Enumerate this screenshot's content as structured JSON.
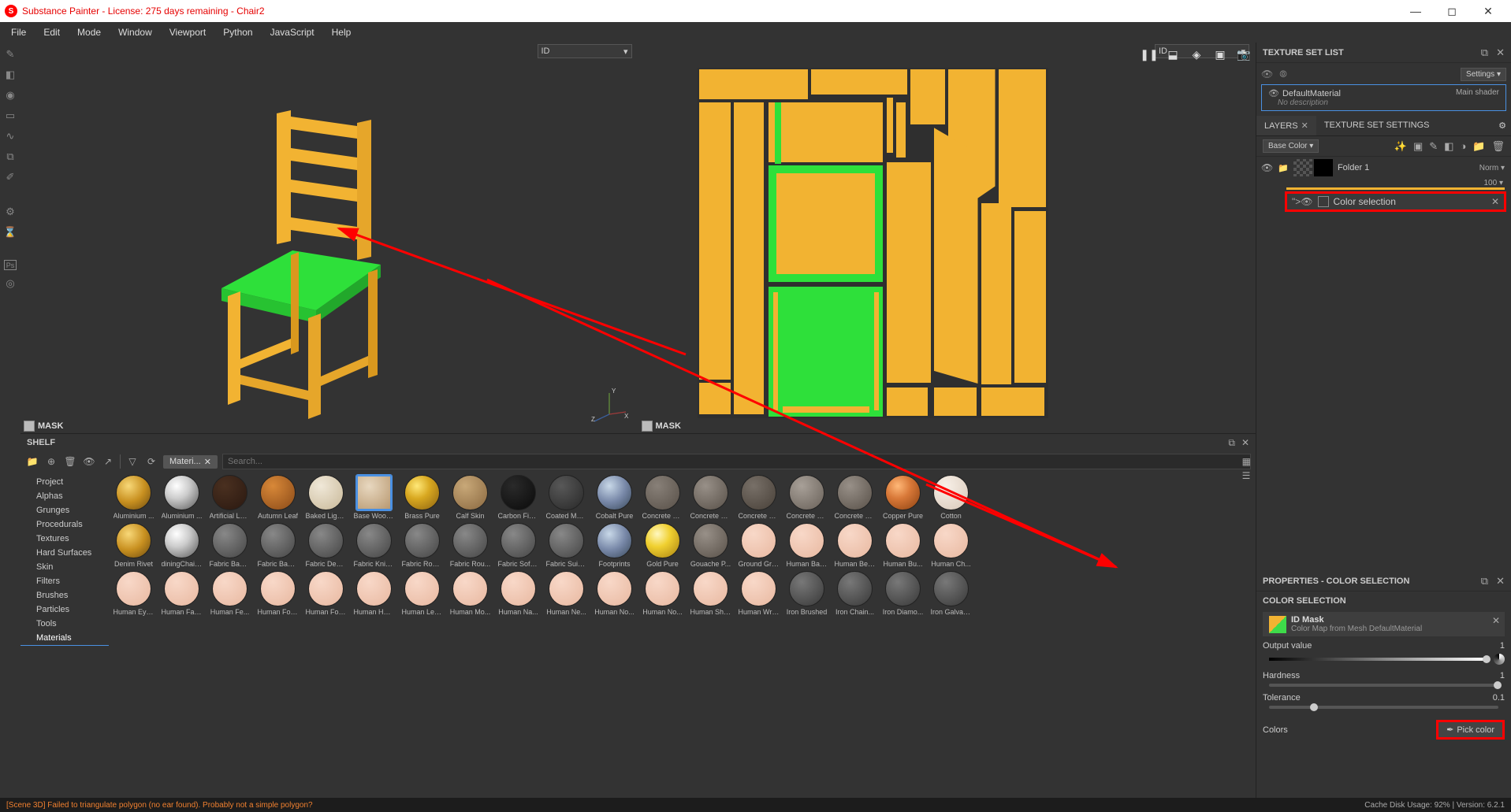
{
  "titlebar": {
    "title": "Substance Painter - License: 275 days remaining - Chair2"
  },
  "menu": [
    "File",
    "Edit",
    "Mode",
    "Window",
    "Viewport",
    "Python",
    "JavaScript",
    "Help"
  ],
  "viewport3d": {
    "dropdown": "ID",
    "footer_label": "MASK"
  },
  "viewport2d": {
    "dropdown": "ID",
    "footer_label": "MASK"
  },
  "shelf": {
    "title": "SHELF",
    "tab_label": "Materi...",
    "search_placeholder": "Search...",
    "categories": [
      "Project",
      "Alphas",
      "Grunges",
      "Procedurals",
      "Textures",
      "Hard Surfaces",
      "Skin",
      "Filters",
      "Brushes",
      "Particles",
      "Tools",
      "Materials"
    ],
    "materials_rows": [
      [
        "Aluminium ...",
        "Aluminium ...",
        "Artificial Lea...",
        "Autumn Leaf",
        "Baked Light...",
        "Base Wood...",
        "Brass Pure",
        "Calf Skin",
        "Carbon Fiber",
        "Coated Metal",
        "Cobalt Pure",
        "Concrete B...",
        "Concrete Cl...",
        "Concrete D...",
        "Concrete Si...",
        "Concrete S...",
        "Copper Pure",
        "Cotton"
      ],
      [
        "Denim Rivet",
        "diningChair...",
        "Fabric Bam...",
        "Fabric Base...",
        "Fabric Deni...",
        "Fabric Knitt...",
        "Fabric Rough",
        "Fabric Rou...",
        "Fabric Soft ...",
        "Fabric Suit ...",
        "Footprints",
        "Gold Pure",
        "Gouache P...",
        "Ground Gra...",
        "Human Bac...",
        "Human Bell...",
        "Human Bu...",
        "Human Ch..."
      ],
      [
        "Human Eye...",
        "Human Fac...",
        "Human Fe...",
        "Human For...",
        "Human For...",
        "Human Hei...",
        "Human Leg...",
        "Human Mo...",
        "Human Na...",
        "Human Ne...",
        "Human No...",
        "Human No...",
        "Human Shi...",
        "Human Wri...",
        "Iron Brushed",
        "Iron Chain...",
        "Iron Diamo...",
        "Iron Galvan..."
      ]
    ]
  },
  "texture_set_list": {
    "title": "TEXTURE SET LIST",
    "settings_label": "Settings",
    "material_name": "DefaultMaterial",
    "shader": "Main shader",
    "desc": "No description"
  },
  "layers_panel": {
    "tab1": "LAYERS",
    "tab2": "TEXTURE SET SETTINGS",
    "channel": "Base Color",
    "folder_name": "Folder 1",
    "blend": "Norm",
    "opacity": "100",
    "color_selection": "Color selection"
  },
  "properties": {
    "title": "PROPERTIES - COLOR SELECTION",
    "section": "COLOR SELECTION",
    "idmask_title": "ID Mask",
    "idmask_sub": "Color Map from Mesh DefaultMaterial",
    "output_label": "Output value",
    "output_val": "1",
    "hardness_label": "Hardness",
    "hardness_val": "1",
    "tolerance_label": "Tolerance",
    "tolerance_val": "0.1",
    "colors_label": "Colors",
    "pick_color": "Pick color"
  },
  "status": {
    "error": "[Scene 3D] Failed to triangulate polygon (no ear found). Probably not a simple polygon?",
    "cache": "Cache Disk Usage:    92% | Version: 6.2.1"
  }
}
